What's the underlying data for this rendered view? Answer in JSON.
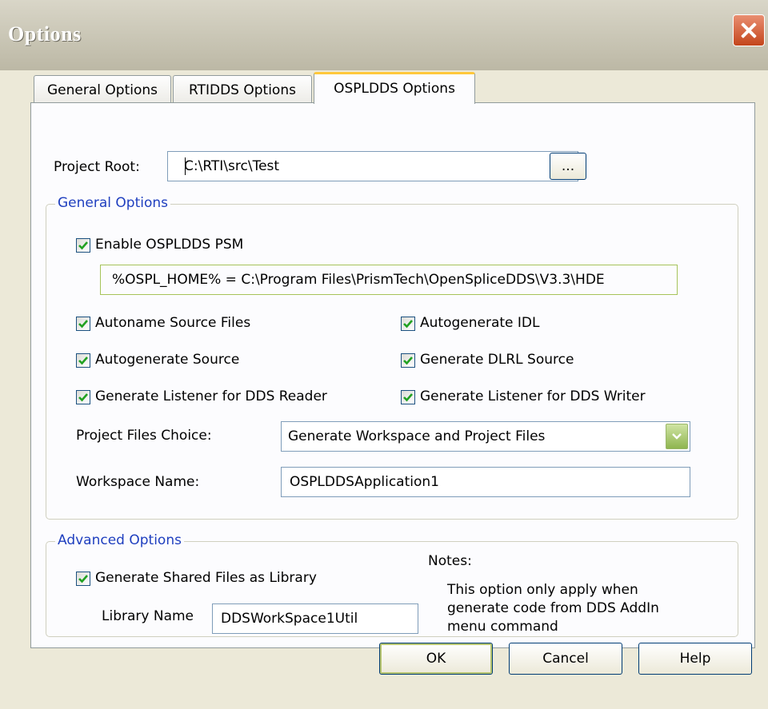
{
  "window": {
    "title": "Options"
  },
  "tabs": [
    {
      "label": "General Options"
    },
    {
      "label": "RTIDDS Options"
    },
    {
      "label": "OSPLDDS Options"
    }
  ],
  "project_root": {
    "label": "Project Root:",
    "value": "C:\\RTI\\src\\Test",
    "browse_label": "..."
  },
  "general_group": {
    "title": "General Options",
    "enable_psm": {
      "label": "Enable OSPLDDS PSM",
      "checked": true
    },
    "osplhome_text": "%OSPL_HOME% = C:\\Program Files\\PrismTech\\OpenSpliceDDS\\V3.3\\HDE",
    "checkboxes": [
      {
        "label": "Autoname Source Files",
        "checked": true
      },
      {
        "label": "Autogenerate IDL",
        "checked": true
      },
      {
        "label": "Autogenerate Source",
        "checked": true
      },
      {
        "label": "Generate DLRL Source",
        "checked": true
      },
      {
        "label": "Generate Listener for DDS Reader",
        "checked": true
      },
      {
        "label": "Generate Listener for DDS Writer",
        "checked": true
      }
    ],
    "project_files_choice": {
      "label": "Project Files Choice:",
      "value": "Generate Workspace and Project Files"
    },
    "workspace_name": {
      "label": "Workspace Name:",
      "value": "OSPLDDSApplication1"
    }
  },
  "advanced_group": {
    "title": "Advanced Options",
    "shared_lib": {
      "label": "Generate Shared Files as Library",
      "checked": true
    },
    "library_name": {
      "label": "Library Name",
      "value": "DDSWorkSpace1Util"
    },
    "notes_title": "Notes:",
    "notes_lines": [
      "This option only apply when",
      "generate code from DDS AddIn",
      "menu command"
    ]
  },
  "buttons": {
    "ok": "OK",
    "cancel": "Cancel",
    "help": "Help"
  },
  "colors": {
    "group_title": "#1f3fbf",
    "close_button": "#c4451c",
    "active_tab_accent": "#ffc83c",
    "checkmark": "#21a121"
  }
}
